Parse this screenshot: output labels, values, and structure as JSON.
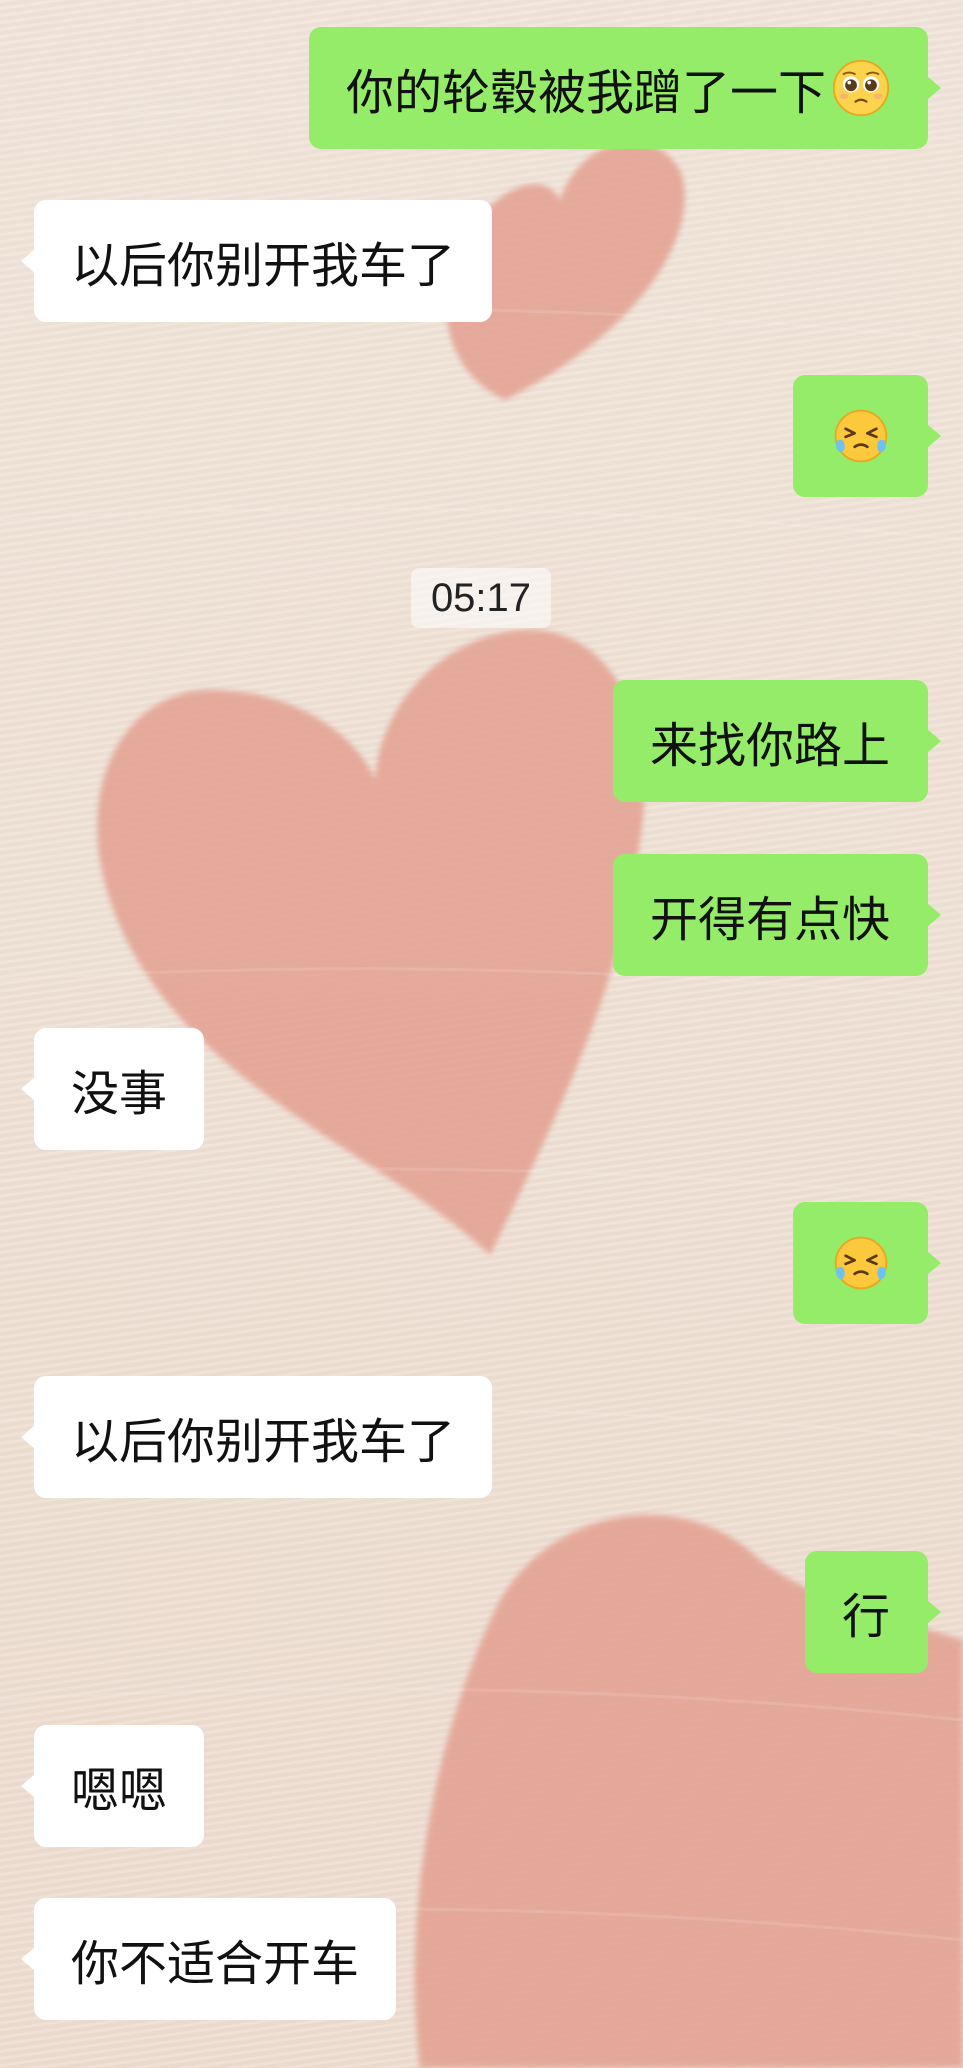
{
  "chat": {
    "timestamp": "05:17",
    "messages": [
      {
        "sender": "me",
        "text": "你的轮毂被我蹭了一下",
        "emoji": "pleading-face-emoji"
      },
      {
        "sender": "them",
        "text": "以后你别开我车了"
      },
      {
        "sender": "me",
        "text": "",
        "emoji": "laughing-crying-face-emoji"
      },
      {
        "sender": "me",
        "text": "来找你路上"
      },
      {
        "sender": "me",
        "text": "开得有点快"
      },
      {
        "sender": "them",
        "text": "没事"
      },
      {
        "sender": "me",
        "text": "",
        "emoji": "laughing-crying-face-emoji"
      },
      {
        "sender": "them",
        "text": "以后你别开我车了"
      },
      {
        "sender": "me",
        "text": "行"
      },
      {
        "sender": "them",
        "text": "嗯嗯"
      },
      {
        "sender": "them",
        "text": "你不适合开车"
      }
    ]
  },
  "colors": {
    "outgoing_bubble": "#95ec69",
    "incoming_bubble": "#ffffff",
    "background": "#f0e2d7",
    "heart": "#e3a091"
  }
}
